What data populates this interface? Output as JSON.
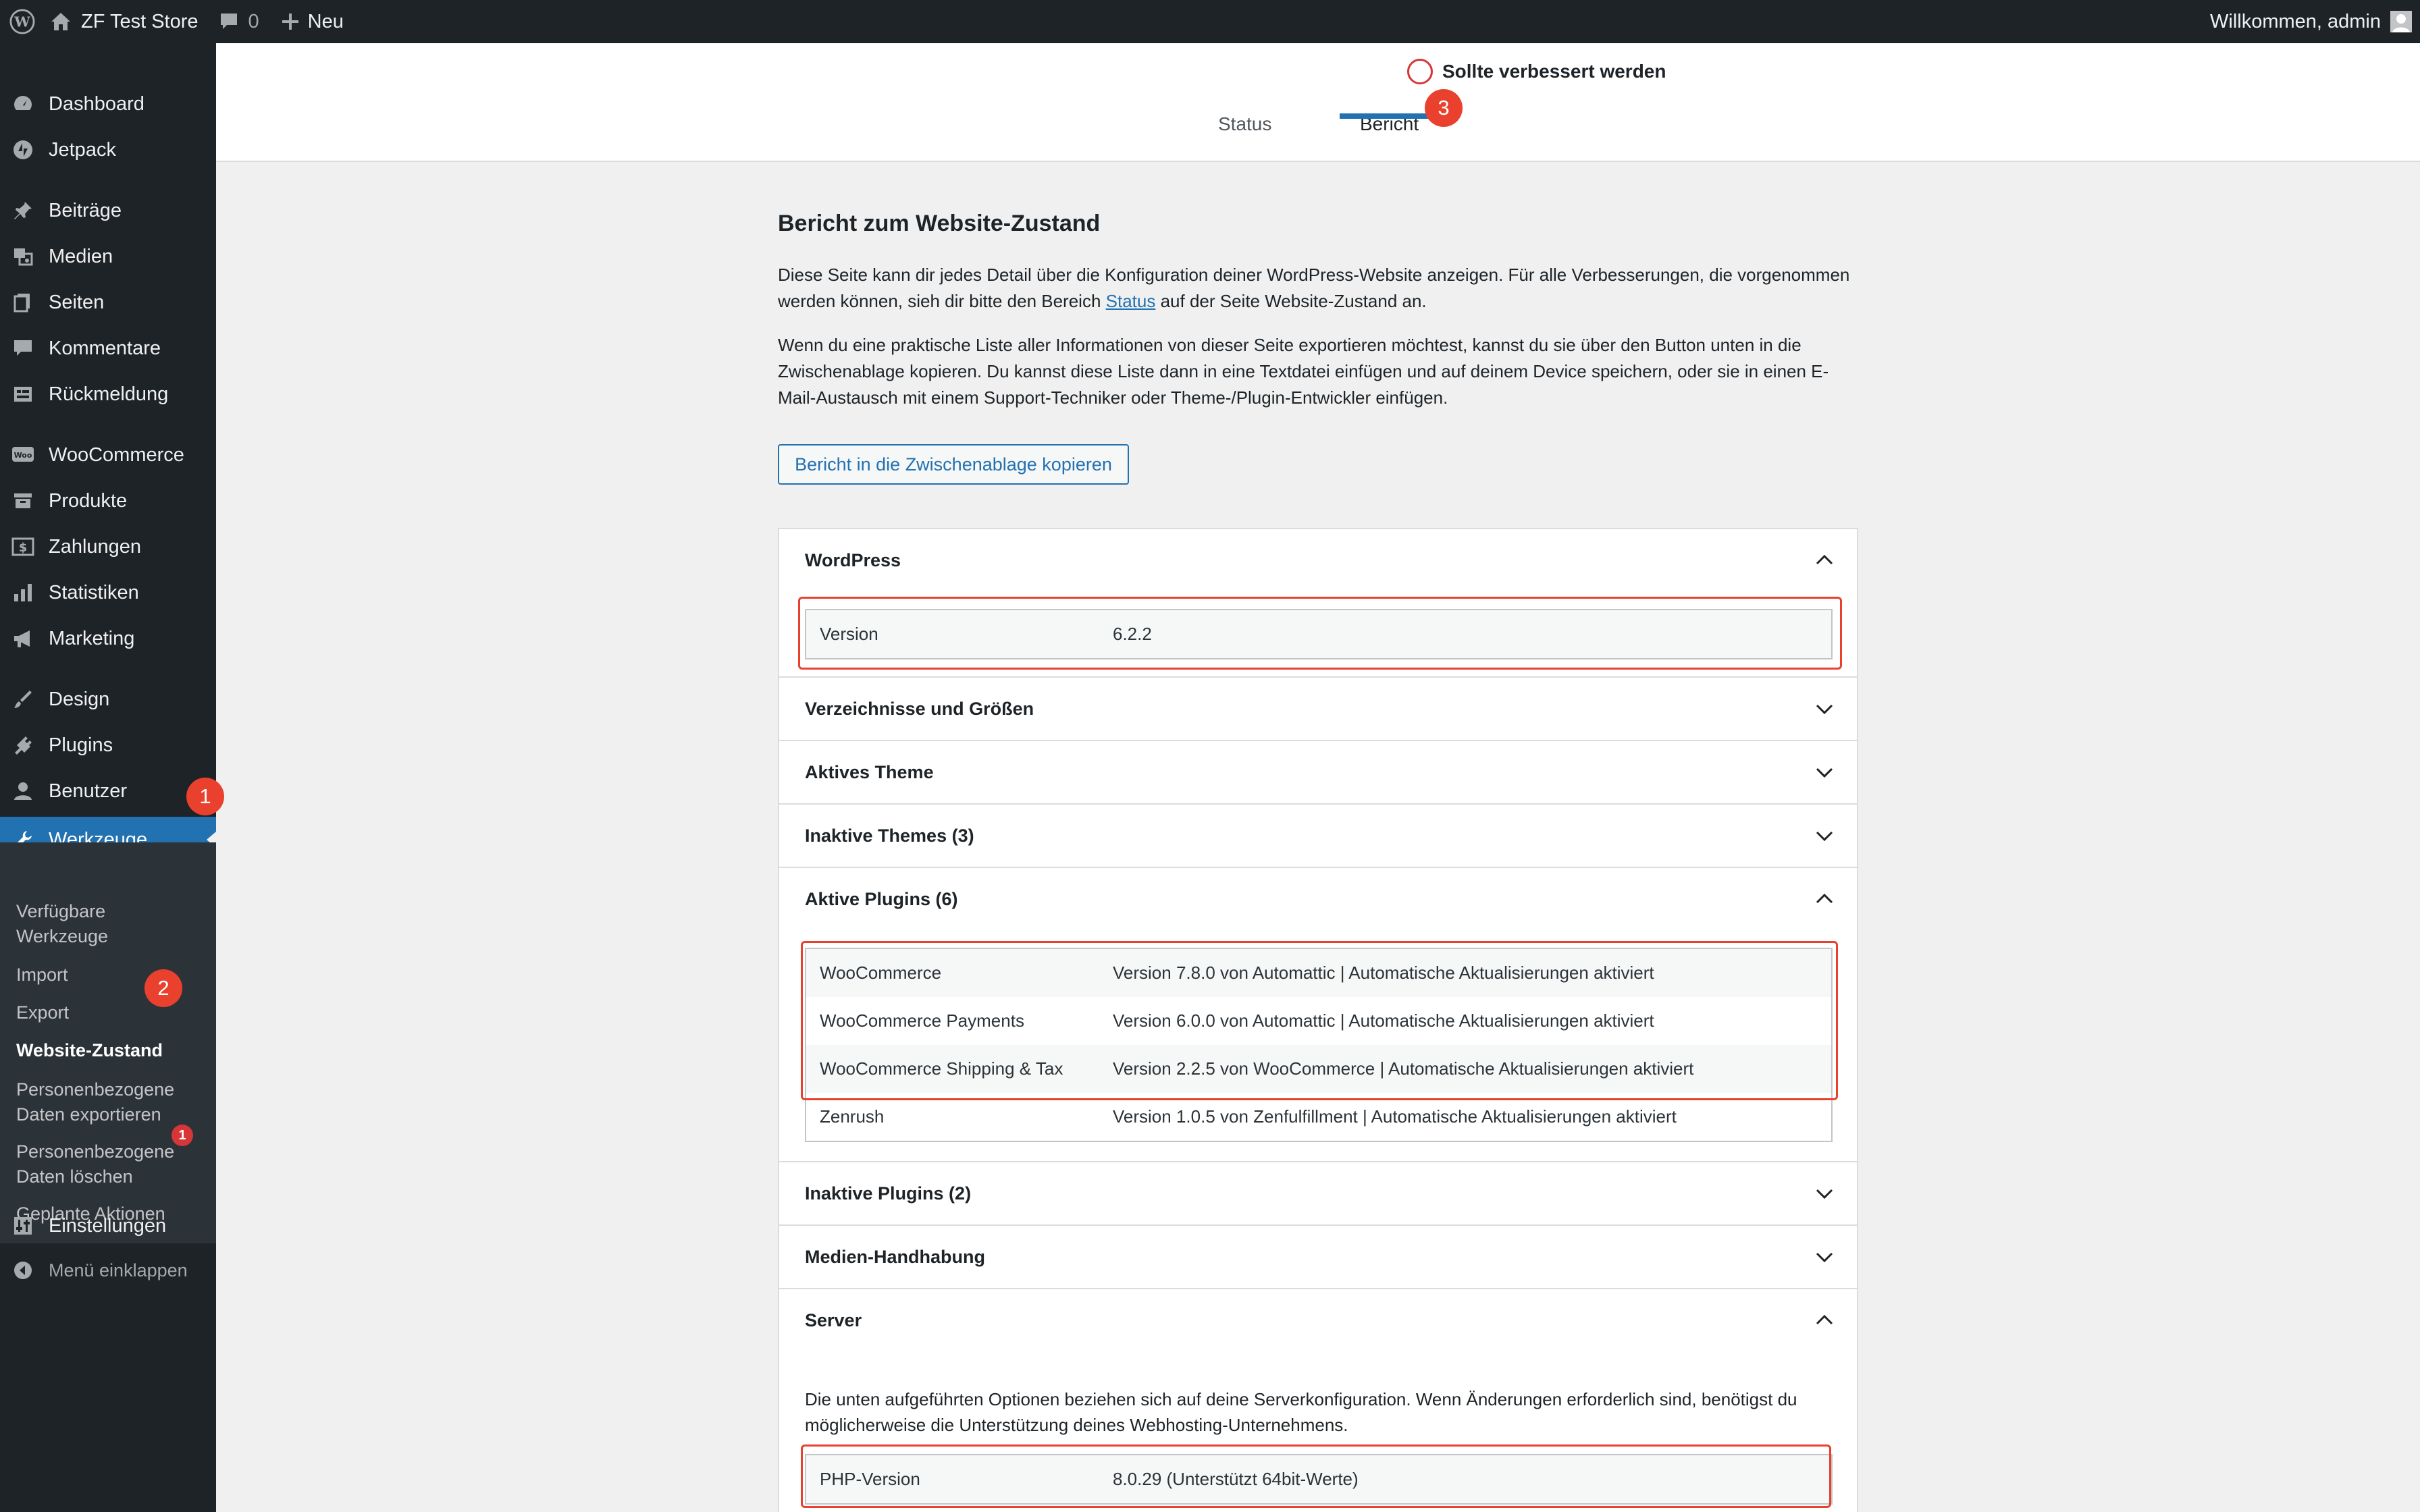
{
  "adminbar": {
    "site_name": "ZF Test Store",
    "comments_count": "0",
    "new_label": "Neu",
    "greeting": "Willkommen, admin"
  },
  "sidebar": {
    "items": [
      {
        "label": "Dashboard",
        "icon": "dashboard-icon"
      },
      {
        "label": "Jetpack",
        "icon": "jetpack-icon"
      },
      {
        "label": "Beiträge",
        "icon": "pin-icon"
      },
      {
        "label": "Medien",
        "icon": "media-icon"
      },
      {
        "label": "Seiten",
        "icon": "pages-icon"
      },
      {
        "label": "Kommentare",
        "icon": "comment-icon"
      },
      {
        "label": "Rückmeldung",
        "icon": "feedback-icon"
      },
      {
        "label": "WooCommerce",
        "icon": "woo-icon"
      },
      {
        "label": "Produkte",
        "icon": "archive-icon"
      },
      {
        "label": "Zahlungen",
        "icon": "money-icon"
      },
      {
        "label": "Statistiken",
        "icon": "chart-icon"
      },
      {
        "label": "Marketing",
        "icon": "megaphone-icon"
      },
      {
        "label": "Design",
        "icon": "brush-icon"
      },
      {
        "label": "Plugins",
        "icon": "plug-icon"
      },
      {
        "label": "Benutzer",
        "icon": "user-icon"
      },
      {
        "label": "Werkzeuge",
        "icon": "wrench-icon"
      },
      {
        "label": "Einstellungen",
        "icon": "settings-icon"
      }
    ],
    "submenu": [
      "Verfügbare\nWerkzeuge",
      "Import",
      "Export",
      "Website-Zustand",
      "Personenbezogene\nDaten exportieren",
      "Personenbezogene\nDaten löschen",
      "Geplante Aktionen"
    ],
    "site_health_count": "1",
    "collapse_label": "Menü einklappen"
  },
  "steps": [
    "1",
    "2",
    "3"
  ],
  "header": {
    "health_status": "Sollte verbessert werden",
    "tabs": [
      "Status",
      "Bericht"
    ]
  },
  "main": {
    "title": "Bericht zum Website-Zustand",
    "para1_a": "Diese Seite kann dir jedes Detail über die Konfiguration deiner WordPress-Website anzeigen. Für alle Verbesserungen, die vorgenommen werden können, sieh dir bitte den Bereich ",
    "para1_link": "Status",
    "para1_b": " auf der Seite Website-Zustand an.",
    "para2": "Wenn du eine praktische Liste aller Informationen von dieser Seite exportieren möchtest, kannst du sie über den Button unten in die Zwischenablage kopieren. Du kannst diese Liste dann in eine Textdatei einfügen und auf deinem Device speichern, oder sie in einen E-Mail-Austausch mit einem Support-Techniker oder Theme-/Plugin-Entwickler einfügen.",
    "copy_button": "Bericht in die Zwischenablage kopieren"
  },
  "sections": {
    "wordpress": {
      "title": "WordPress",
      "rows": [
        {
          "key": "Version",
          "value": "6.2.2"
        }
      ]
    },
    "directories": {
      "title": "Verzeichnisse und Größen"
    },
    "active_theme": {
      "title": "Aktives Theme"
    },
    "inactive_themes": {
      "title": "Inaktive Themes (3)"
    },
    "active_plugins": {
      "title": "Aktive Plugins (6)",
      "rows": [
        {
          "key": "WooCommerce",
          "value": "Version 7.8.0 von Automattic | Automatische Aktualisierungen aktiviert"
        },
        {
          "key": "WooCommerce Payments",
          "value": "Version 6.0.0 von Automattic | Automatische Aktualisierungen aktiviert"
        },
        {
          "key": "WooCommerce Shipping & Tax",
          "value": "Version 2.2.5 von WooCommerce | Automatische Aktualisierungen aktiviert"
        },
        {
          "key": "Zenrush",
          "value": "Version 1.0.5 von Zenfulfillment | Automatische Aktualisierungen aktiviert"
        }
      ]
    },
    "inactive_plugins": {
      "title": "Inaktive Plugins (2)"
    },
    "media": {
      "title": "Medien-Handhabung"
    },
    "server": {
      "title": "Server",
      "description": "Die unten aufgeführten Optionen beziehen sich auf deine Serverkonfiguration. Wenn Änderungen erforderlich sind, benötigst du möglicherweise die Unterstützung deines Webhosting-Unternehmens.",
      "rows": [
        {
          "key": "PHP-Version",
          "value": "8.0.29 (Unterstützt 64bit-Werte)"
        }
      ]
    }
  },
  "colors": {
    "accent": "#2271b1",
    "sidebar": "#1d2327",
    "annotation": "#e9412e",
    "warning": "#d63638"
  }
}
